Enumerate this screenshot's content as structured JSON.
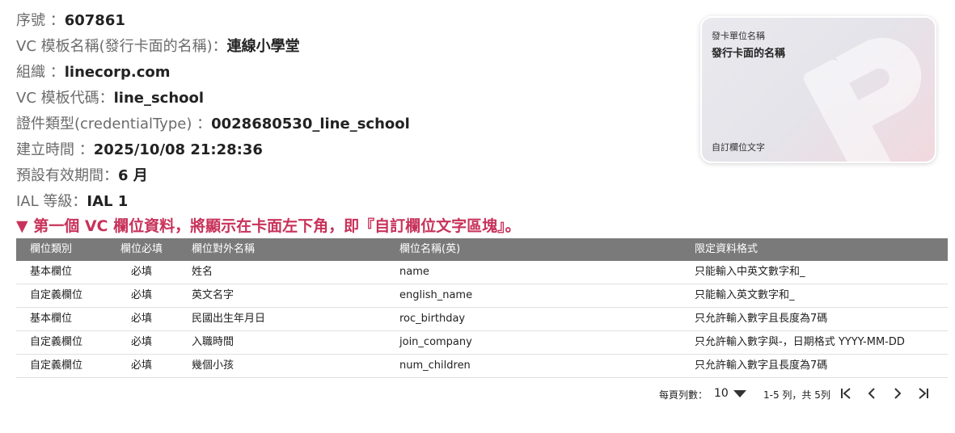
{
  "info": {
    "serial_label": "序號 ：",
    "serial_value": "607861",
    "template_name_label": "VC 模板名稱(發行卡面的名稱)：",
    "template_name_value": "連線小學堂",
    "org_label": "組織 ：",
    "org_value": "linecorp.com",
    "template_code_label": "VC 模板代碼：",
    "template_code_value": "line_school",
    "credential_type_label": "證件類型(credentialType) ：",
    "credential_type_value": "0028680530_line_school",
    "created_label": "建立時間 ：",
    "created_value": "2025/10/08 21:28:36",
    "validity_label": "預設有效期間：",
    "validity_value": "6 月",
    "ial_label": "IAL 等級：",
    "ial_value": "IAL 1"
  },
  "notice": "▼ 第一個 VC 欄位資料，將顯示在卡面左下角，即『自訂欄位文字區塊』。",
  "card": {
    "issuer": "發卡單位名稱",
    "name": "發行卡面的名稱",
    "custom_field": "自訂欄位文字"
  },
  "table": {
    "headers": [
      "欄位類別",
      "欄位必填",
      "欄位對外名稱",
      "欄位名稱(英)",
      "限定資料格式"
    ],
    "rows": [
      [
        "基本欄位",
        "必填",
        "姓名",
        "name",
        "只能輸入中英文數字和_"
      ],
      [
        "自定義欄位",
        "必填",
        "英文名字",
        "english_name",
        "只能輸入英文數字和_"
      ],
      [
        "基本欄位",
        "必填",
        "民國出生年月日",
        "roc_birthday",
        "只允許輸入數字且長度為7碼"
      ],
      [
        "自定義欄位",
        "必填",
        "入職時間",
        "join_company",
        "只允許輸入數字與-，日期格式 YYYY-MM-DD"
      ],
      [
        "自定義欄位",
        "必填",
        "幾個小孩",
        "num_children",
        "只允許輸入數字且長度為7碼"
      ]
    ]
  },
  "pager": {
    "per_page_label": "每頁列數：",
    "page_size": "10",
    "range": "1-5 列，共 5列",
    "icons": [
      "first-page-icon",
      "prev-page-icon",
      "next-page-icon",
      "last-page-icon"
    ]
  },
  "colors": {
    "notice": "#c8325a",
    "table_header": "#7a7a7a"
  }
}
